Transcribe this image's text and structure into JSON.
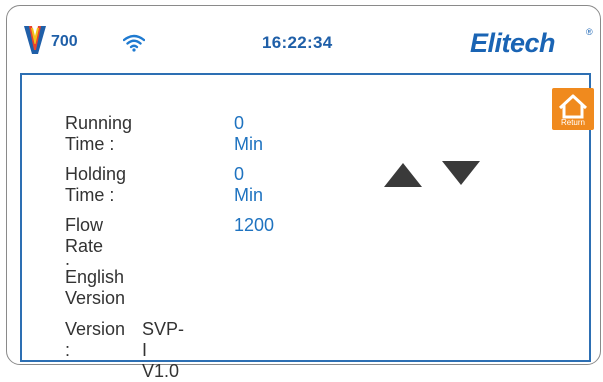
{
  "status_bar": {
    "model": "700",
    "time": "16:22:34",
    "brand": "Elitech",
    "brand_mark": "®",
    "icons": [
      "v-logo-icon",
      "wifi-icon"
    ]
  },
  "settings": {
    "running_time": {
      "label": "Running Time :",
      "value": "0 Min"
    },
    "holding_time": {
      "label": "Holding Time :",
      "value": "0 Min"
    },
    "flow_rate": {
      "label": "Flow Rate :",
      "value": "1200"
    },
    "language": {
      "label": "English Version"
    },
    "version": {
      "label": "Version :",
      "value": "SVP-I   V1.0"
    }
  },
  "controls": {
    "return_label": "Return",
    "icons": [
      "home-icon",
      "arrow-up-icon",
      "arrow-down-icon"
    ]
  },
  "colors": {
    "accent": "#2d6fb3",
    "value_text": "#1f73c0",
    "return_button": "#f08a1e"
  }
}
